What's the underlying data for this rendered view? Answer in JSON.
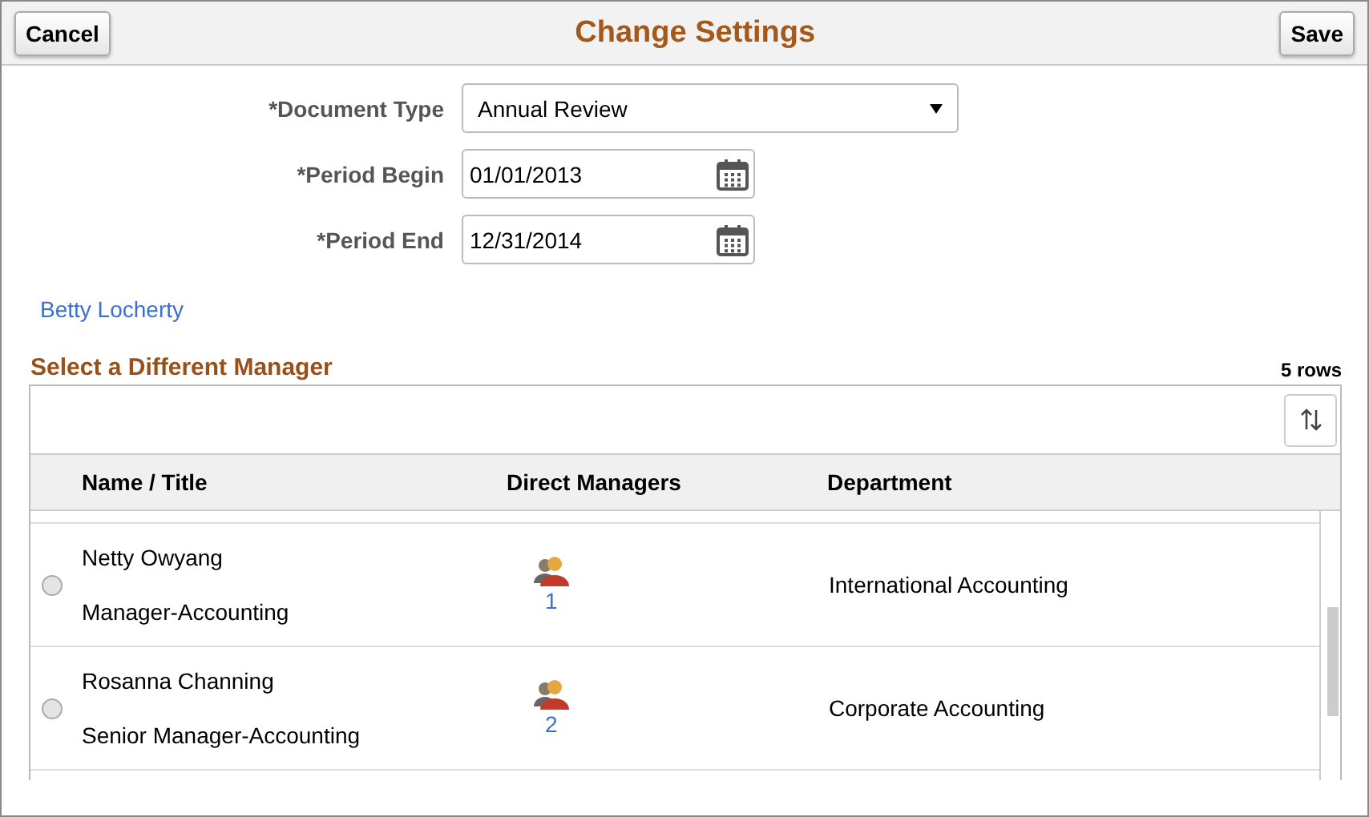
{
  "header": {
    "title": "Change Settings",
    "cancel": "Cancel",
    "save": "Save"
  },
  "form": {
    "document_type": {
      "label": "*Document Type",
      "value": "Annual Review"
    },
    "period_begin": {
      "label": "*Period Begin",
      "value": "01/01/2013"
    },
    "period_end": {
      "label": "*Period End",
      "value": "12/31/2014"
    }
  },
  "employee_link": "Betty Locherty",
  "grid": {
    "title": "Select a Different Manager",
    "row_count": "5 rows",
    "columns": [
      "Name / Title",
      "Direct Managers",
      "Department"
    ],
    "rows": [
      {
        "name": "Netty Owyang",
        "title": "Manager-Accounting",
        "direct_managers": "1",
        "department": "International Accounting",
        "selected": false
      },
      {
        "name": "Rosanna Channing",
        "title": "Senior Manager-Accounting",
        "direct_managers": "2",
        "department": "Corporate Accounting",
        "selected": false
      }
    ]
  }
}
